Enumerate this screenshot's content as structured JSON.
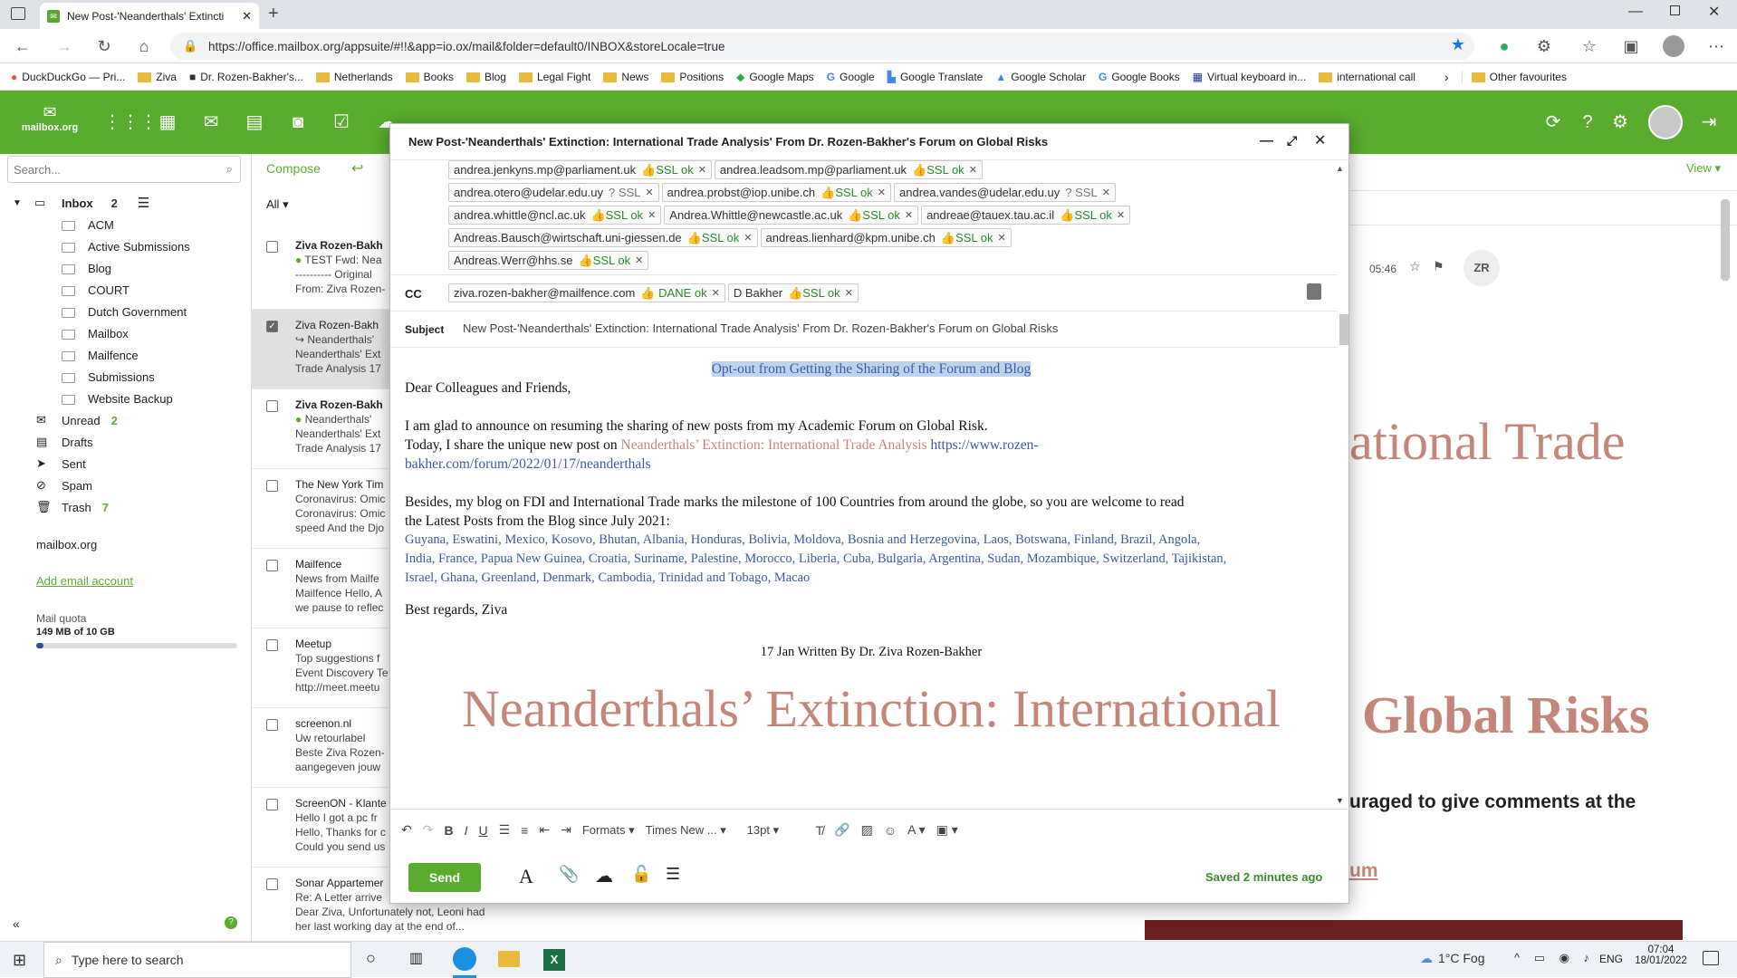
{
  "browser": {
    "tab_title": "New Post-'Neanderthals' Extincti",
    "url": "https://office.mailbox.org/appsuite/#!!&app=io.ox/mail&folder=default0/INBOX&storeLocale=true",
    "bookmarks": [
      "DuckDuckGo — Pri...",
      "Ziva",
      "Dr. Rozen-Bakher's...",
      "Netherlands",
      "Books",
      "Blog",
      "Legal Fight",
      "News",
      "Positions",
      "Google Maps",
      "Google",
      "Google Translate",
      "Google Scholar",
      "Google Books",
      "Virtual keyboard in...",
      "international call"
    ],
    "other_favourites": "Other favourites"
  },
  "app": {
    "logo": "mailbox.org",
    "search_placeholder": "Search...",
    "compose": "Compose",
    "all_filter": "All",
    "view": "View"
  },
  "folders": {
    "inbox_label": "Inbox",
    "inbox_count": "2",
    "subfolders": [
      "ACM",
      "Active Submissions",
      "Blog",
      "COURT",
      "Dutch Government",
      "Mailbox",
      "Mailfence",
      "Submissions",
      "Website Backup"
    ],
    "unread_label": "Unread",
    "unread_count": "2",
    "drafts": "Drafts",
    "sent": "Sent",
    "spam": "Spam",
    "trash": "Trash",
    "trash_count": "7",
    "account": "mailbox.org",
    "add_account": "Add email account",
    "quota_label": "Mail quota",
    "quota_value": "149 MB of 10 GB",
    "quota_fraction": 0.015
  },
  "mails": [
    {
      "from": "Ziva Rozen-Bakh",
      "l2": "TEST Fwd: Nea",
      "l3": "---------- Original",
      "l4": "From: Ziva Rozen-"
    },
    {
      "from": "Ziva Rozen-Bakh",
      "l2": "Neanderthals'",
      "l3": "Neanderthals' Ext",
      "l4": "Trade Analysis 17"
    },
    {
      "from": "Ziva Rozen-Bakh",
      "l2": "Neanderthals'",
      "l3": "Neanderthals' Ext",
      "l4": "Trade Analysis 17"
    },
    {
      "from": "The New York Tim",
      "l2": "Coronavirus: Omic",
      "l3": "Coronavirus: Omic",
      "l4": "speed And the Djo"
    },
    {
      "from": "Mailfence",
      "l2": "News from Mailfe",
      "l3": "Mailfence Hello, A",
      "l4": "we pause to reflec"
    },
    {
      "from": "Meetup",
      "l2": "Top suggestions f",
      "l3": "Event Discovery Te",
      "l4": "http://meet.meetu"
    },
    {
      "from": "screenon.nl",
      "l2": "Uw retourlabel",
      "l3": "Beste Ziva Rozen-",
      "l4": "aangegeven jouw"
    },
    {
      "from": "ScreenON - Klante",
      "l2": "Hello I got a pc fr",
      "l3": "Hello, Thanks for c",
      "l4": "Could you send us"
    },
    {
      "from": "Sonar Appartemer",
      "l2": "Re: A Letter arrive",
      "l3": "Dear Ziva, Unfortunately not, Leoni had",
      "l4": "her last working day at the end of..."
    }
  ],
  "reader": {
    "time": "05:46",
    "avatar": "ZR",
    "bg_title1": "ational Trade",
    "bg_title2": "Global Risks",
    "bg_sub": "uraged to give comments at the",
    "bg_link": "um"
  },
  "compose": {
    "title": "New Post-'Neanderthals' Extinction: International Trade Analysis' From Dr. Rozen-Bakher's Forum on Global Risks",
    "to_rows": [
      [
        {
          "email": "andrea.jenkyns.mp@parliament.uk",
          "ssl": "SSL ok",
          "ok": true
        },
        {
          "email": "andrea.leadsom.mp@parliament.uk",
          "ssl": "SSL ok",
          "ok": true
        }
      ],
      [
        {
          "email": "andrea.otero@udelar.edu.uy",
          "ssl": "SSL",
          "ok": false
        },
        {
          "email": "andrea.probst@iop.unibe.ch",
          "ssl": "SSL ok",
          "ok": true
        },
        {
          "email": "andrea.vandes@udelar.edu.uy",
          "ssl": "SSL",
          "ok": false
        }
      ],
      [
        {
          "email": "andrea.whittle@ncl.ac.uk",
          "ssl": "SSL ok",
          "ok": true
        },
        {
          "email": "Andrea.Whittle@newcastle.ac.uk",
          "ssl": "SSL ok",
          "ok": true
        },
        {
          "email": "andreae@tauex.tau.ac.il",
          "ssl": "SSL ok",
          "ok": true
        }
      ],
      [
        {
          "email": "Andreas.Bausch@wirtschaft.uni-giessen.de",
          "ssl": "SSL ok",
          "ok": true
        },
        {
          "email": "andreas.lienhard@kpm.unibe.ch",
          "ssl": "SSL ok",
          "ok": true
        }
      ],
      [
        {
          "email": "Andreas.Werr@hhs.se",
          "ssl": "SSL ok",
          "ok": true
        }
      ]
    ],
    "cc_label": "CC",
    "cc": [
      {
        "email": "ziva.rozen-bakher@mailfence.com",
        "ssl": "DANE ok",
        "ok": true
      },
      {
        "email": "D Bakher",
        "ssl": "SSL ok",
        "ok": true
      }
    ],
    "subject_label": "Subject",
    "subject": "New Post-'Neanderthals' Extinction: International Trade Analysis' From Dr. Rozen-Bakher's Forum on Global Risks",
    "optout": "Opt-out from Getting the Sharing of the Forum and Blog",
    "greeting": "Dear Colleagues and Friends,",
    "p1": "I am glad to announce on resuming the sharing of new posts from my Academic Forum on Global Risk.",
    "p2_start": "Today, I share the unique new post on ",
    "p2_title": "Neanderthals’ Extinction: International Trade Analysis",
    "p2_link1": "https://www.rozen-",
    "p2_link2": "bakher.com/forum/2022/01/17/neanderthals",
    "p3a": "Besides, my blog on FDI and International Trade marks the milestone of 100 Countries from around the globe, so you are welcome to read",
    "p3b": "the Latest Posts from the Blog since July 2021:",
    "countries1": "Guyana, Eswatini, Mexico, Kosovo, Bhutan, Albania, Honduras, Bolivia, Moldova, Bosnia and Herzegovina, Laos, Botswana, Finland, Brazil, Angola,",
    "countries2": "India, France, Papua New Guinea, Croatia, Suriname, Palestine, Morocco, Liberia, Cuba, Bulgaria, Argentina, Sudan, Mozambique, Switzerland, Tajikistan,",
    "countries3": "Israel, Ghana, Greenland, Denmark, Cambodia, Trinidad and Tobago, Macao",
    "regards": "Best regards, Ziva",
    "byline": "17 Jan Written By Dr. Ziva Rozen-Bakher",
    "big_title": "Neanderthals’ Extinction: International",
    "toolbar_formats": "Formats",
    "toolbar_font": "Times New ...",
    "toolbar_size": "13pt",
    "send": "Send",
    "saved": "Saved 2 minutes ago"
  },
  "taskbar": {
    "search": "Type here to search",
    "weather": "1°C Fog",
    "lang": "ENG",
    "time": "07:04",
    "date": "18/01/2022"
  }
}
